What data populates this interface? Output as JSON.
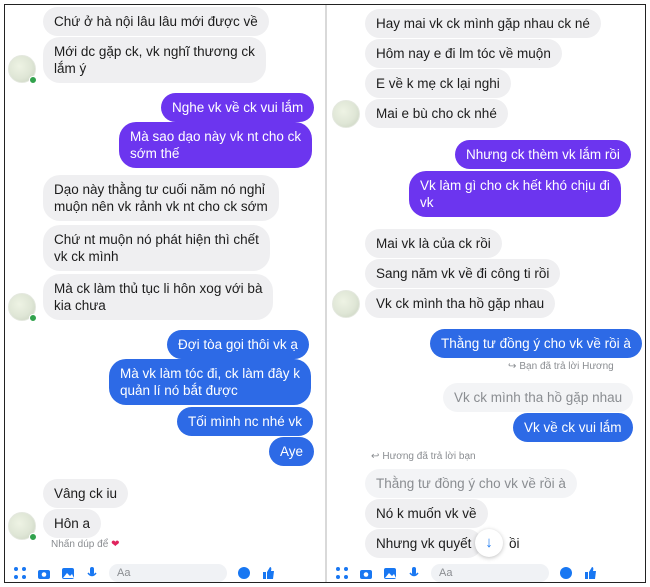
{
  "left": {
    "messages": [
      "Chứ ở hà nội lâu lâu mới được về",
      "Mới dc gặp ck, vk nghĩ thương ck\nlắm ý",
      "Nghe vk về ck vui lắm",
      "Mà sao dạo này vk nt cho ck\nsớm thế",
      "Dạo này thằng tư cuối năm nó nghỉ\nmuộn nên vk rảnh vk nt cho ck sớm",
      "Chứ nt muộn nó phát hiện thì chết\nvk ck mình",
      "Mà ck làm thủ tục li hôn xog với bà\nkia chưa",
      "Đợi tòa gọi thôi vk ạ",
      "Mà vk làm tóc đi, ck làm đây k\nquản lí nó bắt được",
      "Tối mình nc nhé vk",
      "Aye",
      "Vâng ck iu",
      "Hôn a"
    ],
    "reaction_note": "Nhấn dúp để",
    "reaction_emoji": "❤",
    "composer_placeholder": "Aa"
  },
  "right": {
    "messages": [
      "Hay mai vk ck mình gặp nhau ck né",
      "Hôm nay e đi lm tóc về muộn",
      "E về k mẹ ck lại nghi",
      "Mai e bù cho ck nhé",
      "Nhưng ck thèm vk lắm rồi",
      "Vk làm gì cho ck hết khó chịu đi\nvk",
      "Mai vk  là của ck rồi",
      "Sang năm vk về đi công ti rồi",
      "Vk ck mình tha hồ gặp nhau",
      "Thằng tư đồng ý cho vk về rồi à",
      "Vk về ck vui lắm",
      "Nó k muốn vk về",
      "Nhưng vk quyết",
      "ồi"
    ],
    "reply_note_1": "Bạn đã trả lời Hương",
    "quoted_1": "Vk ck mình tha hồ gặp nhau",
    "reply_note_2": "Hương đã trả lời bạn",
    "quoted_2": "Thằng tư đồng ý cho vk về rồi à",
    "composer_placeholder": "Aa"
  },
  "colors": {
    "outgoing_purple": "#6c35ef",
    "outgoing_blue": "#2d6ae6",
    "incoming_gray": "#efeff1",
    "online_green": "#31a24c",
    "messenger_blue": "#1877f2"
  }
}
